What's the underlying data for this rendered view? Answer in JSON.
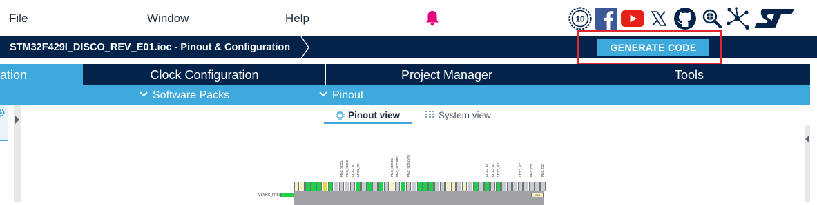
{
  "menu": {
    "file": "File",
    "window": "Window",
    "help": "Help"
  },
  "icons": {
    "bell": "notification-bell-icon",
    "badge": "anniversary-10-badge-icon",
    "facebook": "facebook-icon",
    "youtube": "youtube-icon",
    "x": "x-twitter-icon",
    "github": "github-icon",
    "community": "st-community-icon",
    "network": "network-share-icon",
    "logo": "st-logo-icon"
  },
  "breadcrumb": {
    "title": "STM32F429I_DISCO_REV_E01.ioc - Pinout & Configuration"
  },
  "toolbar": {
    "generate_label": "GENERATE CODE"
  },
  "tabs": [
    {
      "label": "ation",
      "active": true
    },
    {
      "label": "Clock Configuration",
      "active": false
    },
    {
      "label": "Project Manager",
      "active": false
    },
    {
      "label": "Tools",
      "active": false
    }
  ],
  "subtabs": {
    "software_packs": "Software Packs",
    "pinout": "Pinout"
  },
  "views": {
    "pinout": "Pinout view",
    "system": "System view"
  },
  "chip": {
    "side_label": "VSYNC_FREQ",
    "vdd_label": "VDD",
    "top_labels": [
      "FMC_SDCL",
      "FMC_SDNE",
      "LTDC_R7",
      "LTDC_R6",
      "FMC_SDNE1",
      "FMC_SDCKE1",
      "FMC_SDNCAS",
      "LTDC_B4",
      "LTDC_B3",
      "LTDC_G3",
      "LTDC_G7",
      "FMC_D3",
      "FMC_D2"
    ],
    "pin_colors": [
      "#f8eec2",
      "#f8eec2",
      "#1fd14a",
      "#1fd14a",
      "#1fd14a",
      "#e9d44a",
      "#1fd14a",
      "#c9ccd0",
      "#c9ccd0",
      "#c9ccd0",
      "#c9ccd0",
      "#1fd14a",
      "#c9ccd0",
      "#1fd14a",
      "#c9ccd0",
      "#1fd14a",
      "#c9ccd0",
      "#f8eec2",
      "#c9ccd0",
      "#1fd14a",
      "#c9ccd0",
      "#c9ccd0",
      "#1fd14a",
      "#1fd14a",
      "#1fd14a",
      "#c9ccd0",
      "#c9ccd0",
      "#f8eec2",
      "#f8eec2",
      "#c9ccd0",
      "#f8eec2",
      "#c9ccd0",
      "#1fd14a",
      "#c9ccd0",
      "#1fd14a",
      "#c9ccd0",
      "#1fd14a",
      "#c9ccd0",
      "#c9ccd0",
      "#c9ccd0",
      "#c9ccd0",
      "#c9ccd0",
      "#c9ccd0",
      "#c9ccd0",
      "#c9ccd0"
    ]
  },
  "colors": {
    "navy": "#03234b",
    "accent": "#3ea9dc",
    "highlight": "#e0262f",
    "bell": "#e6007e"
  }
}
